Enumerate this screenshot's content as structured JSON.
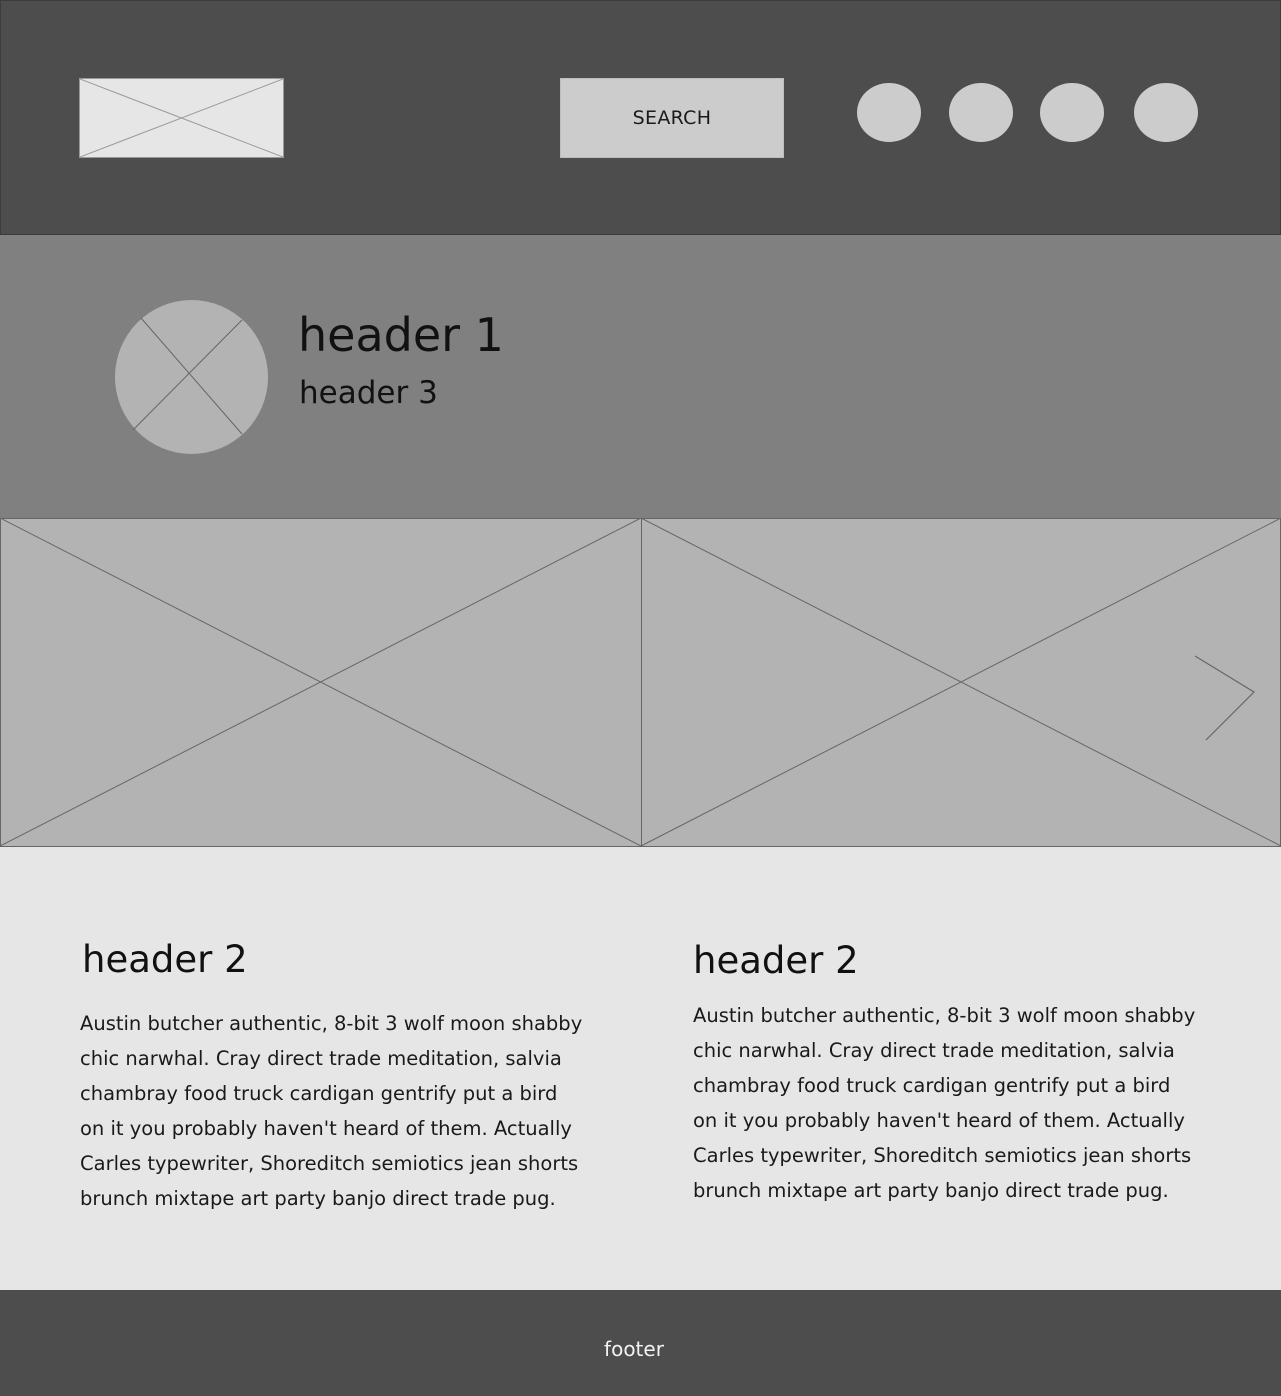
{
  "header": {
    "search_label": "SEARCH",
    "nav_items": [
      "nav-1",
      "nav-2",
      "nav-3",
      "nav-4"
    ]
  },
  "hero": {
    "title": "header 1",
    "subtitle": "header 3"
  },
  "carousel": {
    "next_icon": "chevron-right-icon"
  },
  "columns": [
    {
      "title": "header 2",
      "body": "Austin butcher authentic, 8-bit 3 wolf moon shabby chic narwhal. Cray direct trade meditation, salvia chambray food truck cardigan gentrify put a bird on it you probably haven't heard of them. Actually Carles typewriter, Shoreditch semiotics jean shorts brunch mixtape art party banjo direct trade pug."
    },
    {
      "title": "header 2",
      "body": "Austin butcher authentic, 8-bit 3 wolf moon shabby chic narwhal. Cray direct trade meditation, salvia chambray food truck cardigan gentrify put a bird on it you probably haven't heard of them. Actually Carles typewriter, Shoreditch semiotics jean shorts brunch mixtape art party banjo direct trade pug."
    }
  ],
  "footer": {
    "label": "footer"
  },
  "colors": {
    "dark_bar": "#4d4d4d",
    "hero_bg": "#808080",
    "placeholder": "#b3b3b3",
    "content_bg": "#e6e6e6",
    "button_bg": "#cccccc"
  }
}
